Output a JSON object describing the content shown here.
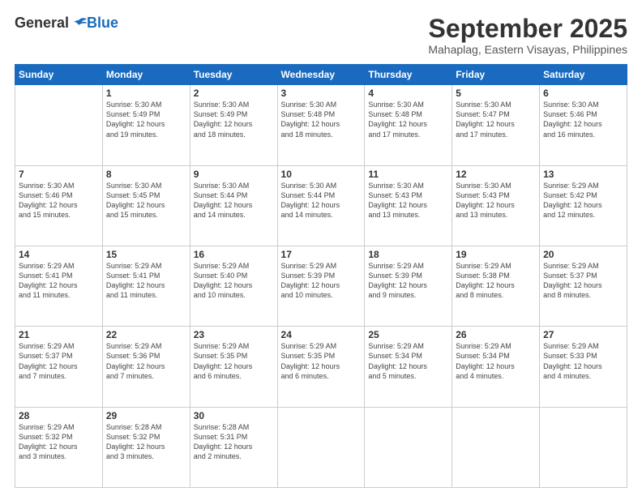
{
  "header": {
    "logo_general": "General",
    "logo_blue": "Blue",
    "month": "September 2025",
    "location": "Mahaplag, Eastern Visayas, Philippines"
  },
  "days_of_week": [
    "Sunday",
    "Monday",
    "Tuesday",
    "Wednesday",
    "Thursday",
    "Friday",
    "Saturday"
  ],
  "weeks": [
    [
      {
        "day": "",
        "lines": []
      },
      {
        "day": "1",
        "lines": [
          "Sunrise: 5:30 AM",
          "Sunset: 5:49 PM",
          "Daylight: 12 hours",
          "and 19 minutes."
        ]
      },
      {
        "day": "2",
        "lines": [
          "Sunrise: 5:30 AM",
          "Sunset: 5:49 PM",
          "Daylight: 12 hours",
          "and 18 minutes."
        ]
      },
      {
        "day": "3",
        "lines": [
          "Sunrise: 5:30 AM",
          "Sunset: 5:48 PM",
          "Daylight: 12 hours",
          "and 18 minutes."
        ]
      },
      {
        "day": "4",
        "lines": [
          "Sunrise: 5:30 AM",
          "Sunset: 5:48 PM",
          "Daylight: 12 hours",
          "and 17 minutes."
        ]
      },
      {
        "day": "5",
        "lines": [
          "Sunrise: 5:30 AM",
          "Sunset: 5:47 PM",
          "Daylight: 12 hours",
          "and 17 minutes."
        ]
      },
      {
        "day": "6",
        "lines": [
          "Sunrise: 5:30 AM",
          "Sunset: 5:46 PM",
          "Daylight: 12 hours",
          "and 16 minutes."
        ]
      }
    ],
    [
      {
        "day": "7",
        "lines": [
          "Sunrise: 5:30 AM",
          "Sunset: 5:46 PM",
          "Daylight: 12 hours",
          "and 15 minutes."
        ]
      },
      {
        "day": "8",
        "lines": [
          "Sunrise: 5:30 AM",
          "Sunset: 5:45 PM",
          "Daylight: 12 hours",
          "and 15 minutes."
        ]
      },
      {
        "day": "9",
        "lines": [
          "Sunrise: 5:30 AM",
          "Sunset: 5:44 PM",
          "Daylight: 12 hours",
          "and 14 minutes."
        ]
      },
      {
        "day": "10",
        "lines": [
          "Sunrise: 5:30 AM",
          "Sunset: 5:44 PM",
          "Daylight: 12 hours",
          "and 14 minutes."
        ]
      },
      {
        "day": "11",
        "lines": [
          "Sunrise: 5:30 AM",
          "Sunset: 5:43 PM",
          "Daylight: 12 hours",
          "and 13 minutes."
        ]
      },
      {
        "day": "12",
        "lines": [
          "Sunrise: 5:30 AM",
          "Sunset: 5:43 PM",
          "Daylight: 12 hours",
          "and 13 minutes."
        ]
      },
      {
        "day": "13",
        "lines": [
          "Sunrise: 5:29 AM",
          "Sunset: 5:42 PM",
          "Daylight: 12 hours",
          "and 12 minutes."
        ]
      }
    ],
    [
      {
        "day": "14",
        "lines": [
          "Sunrise: 5:29 AM",
          "Sunset: 5:41 PM",
          "Daylight: 12 hours",
          "and 11 minutes."
        ]
      },
      {
        "day": "15",
        "lines": [
          "Sunrise: 5:29 AM",
          "Sunset: 5:41 PM",
          "Daylight: 12 hours",
          "and 11 minutes."
        ]
      },
      {
        "day": "16",
        "lines": [
          "Sunrise: 5:29 AM",
          "Sunset: 5:40 PM",
          "Daylight: 12 hours",
          "and 10 minutes."
        ]
      },
      {
        "day": "17",
        "lines": [
          "Sunrise: 5:29 AM",
          "Sunset: 5:39 PM",
          "Daylight: 12 hours",
          "and 10 minutes."
        ]
      },
      {
        "day": "18",
        "lines": [
          "Sunrise: 5:29 AM",
          "Sunset: 5:39 PM",
          "Daylight: 12 hours",
          "and 9 minutes."
        ]
      },
      {
        "day": "19",
        "lines": [
          "Sunrise: 5:29 AM",
          "Sunset: 5:38 PM",
          "Daylight: 12 hours",
          "and 8 minutes."
        ]
      },
      {
        "day": "20",
        "lines": [
          "Sunrise: 5:29 AM",
          "Sunset: 5:37 PM",
          "Daylight: 12 hours",
          "and 8 minutes."
        ]
      }
    ],
    [
      {
        "day": "21",
        "lines": [
          "Sunrise: 5:29 AM",
          "Sunset: 5:37 PM",
          "Daylight: 12 hours",
          "and 7 minutes."
        ]
      },
      {
        "day": "22",
        "lines": [
          "Sunrise: 5:29 AM",
          "Sunset: 5:36 PM",
          "Daylight: 12 hours",
          "and 7 minutes."
        ]
      },
      {
        "day": "23",
        "lines": [
          "Sunrise: 5:29 AM",
          "Sunset: 5:35 PM",
          "Daylight: 12 hours",
          "and 6 minutes."
        ]
      },
      {
        "day": "24",
        "lines": [
          "Sunrise: 5:29 AM",
          "Sunset: 5:35 PM",
          "Daylight: 12 hours",
          "and 6 minutes."
        ]
      },
      {
        "day": "25",
        "lines": [
          "Sunrise: 5:29 AM",
          "Sunset: 5:34 PM",
          "Daylight: 12 hours",
          "and 5 minutes."
        ]
      },
      {
        "day": "26",
        "lines": [
          "Sunrise: 5:29 AM",
          "Sunset: 5:34 PM",
          "Daylight: 12 hours",
          "and 4 minutes."
        ]
      },
      {
        "day": "27",
        "lines": [
          "Sunrise: 5:29 AM",
          "Sunset: 5:33 PM",
          "Daylight: 12 hours",
          "and 4 minutes."
        ]
      }
    ],
    [
      {
        "day": "28",
        "lines": [
          "Sunrise: 5:29 AM",
          "Sunset: 5:32 PM",
          "Daylight: 12 hours",
          "and 3 minutes."
        ]
      },
      {
        "day": "29",
        "lines": [
          "Sunrise: 5:28 AM",
          "Sunset: 5:32 PM",
          "Daylight: 12 hours",
          "and 3 minutes."
        ]
      },
      {
        "day": "30",
        "lines": [
          "Sunrise: 5:28 AM",
          "Sunset: 5:31 PM",
          "Daylight: 12 hours",
          "and 2 minutes."
        ]
      },
      {
        "day": "",
        "lines": []
      },
      {
        "day": "",
        "lines": []
      },
      {
        "day": "",
        "lines": []
      },
      {
        "day": "",
        "lines": []
      }
    ]
  ]
}
